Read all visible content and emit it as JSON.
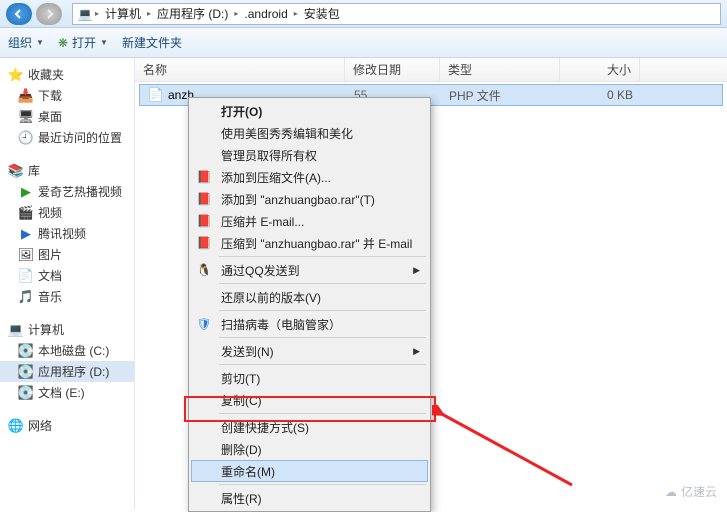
{
  "titlebar": {
    "breadcrumb": [
      "计算机",
      "应用程序 (D:)",
      ".android",
      "安装包"
    ]
  },
  "toolbar": {
    "organize": "组织",
    "open": "打开",
    "newfolder": "新建文件夹"
  },
  "sidebar": {
    "favorites": {
      "label": "收藏夹",
      "items": [
        "下载",
        "桌面",
        "最近访问的位置"
      ]
    },
    "library": {
      "label": "库",
      "items": [
        "爱奇艺热播视频",
        "视频",
        "腾讯视频",
        "图片",
        "文档",
        "音乐"
      ]
    },
    "computer": {
      "label": "计算机",
      "items": [
        "本地磁盘 (C:)",
        "应用程序 (D:)",
        "文档 (E:)"
      ]
    },
    "network": {
      "label": "网络"
    }
  },
  "columns": {
    "name": "名称",
    "date": "修改日期",
    "type": "类型",
    "size": "大小"
  },
  "file": {
    "name": "anzh",
    "date": "55",
    "type": "PHP 文件",
    "size": "0 KB"
  },
  "context": {
    "open": "打开(O)",
    "meitu": "使用美图秀秀编辑和美化",
    "admin": "管理员取得所有权",
    "add_archive": "添加到压缩文件(A)...",
    "add_rar": "添加到 \"anzhuangbao.rar\"(T)",
    "email": "压缩并 E-mail...",
    "email_rar": "压缩到 \"anzhuangbao.rar\" 并 E-mail",
    "qq_send": "通过QQ发送到",
    "prev_ver": "还原以前的版本(V)",
    "scan": "扫描病毒（电脑管家）",
    "send_to": "发送到(N)",
    "cut": "剪切(T)",
    "copy": "复制(C)",
    "shortcut": "创建快捷方式(S)",
    "delete": "删除(D)",
    "rename": "重命名(M)",
    "props": "属性(R)"
  },
  "watermark": "亿速云"
}
